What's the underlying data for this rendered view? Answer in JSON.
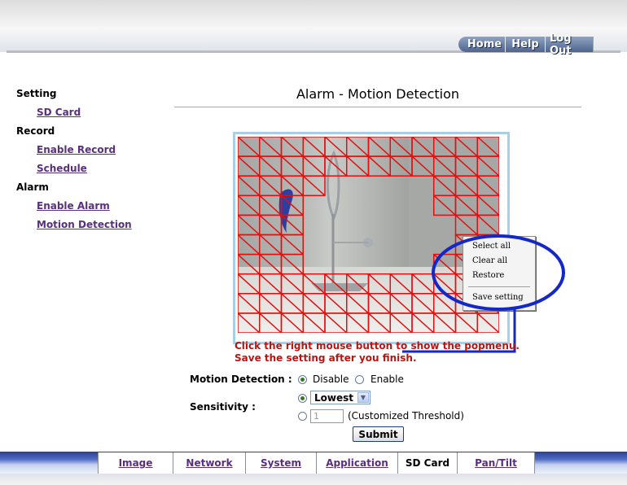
{
  "top_nav": {
    "home": "Home",
    "help": "Help",
    "logout": "Log Out"
  },
  "sidebar": {
    "setting": "Setting",
    "sd_card": "SD Card",
    "record": "Record",
    "enable_record": "Enable Record",
    "schedule": "Schedule",
    "alarm": "Alarm",
    "enable_alarm": "Enable Alarm",
    "motion_detection": "Motion Detection"
  },
  "page_title": "Alarm - Motion Detection",
  "context_menu": {
    "select_all": "Select all",
    "clear_all": "Clear all",
    "restore": "Restore",
    "save_setting": "Save setting"
  },
  "hints": {
    "line1": "Click the right mouse button to show the popmenu.",
    "line2": "Save the setting after you finish."
  },
  "form": {
    "motion_detection_label": "Motion Detection :",
    "disable": "Disable",
    "enable": "Enable",
    "motion_selected": "Disable",
    "sensitivity_label": "Sensitivity :",
    "sensitivity_value": "Lowest",
    "threshold_value": "1",
    "threshold_label": "(Customized Threshold)",
    "submit": "Submit"
  },
  "bottom_tabs": [
    "Image",
    "Network",
    "System",
    "Application",
    "SD Card",
    "Pan/Tilt"
  ],
  "active_tab": "SD Card",
  "colors": {
    "grid_red": "#e01010",
    "callout_blue": "#1428c8",
    "hint_red": "#b8160f",
    "link_purple": "#5a2f7d"
  }
}
